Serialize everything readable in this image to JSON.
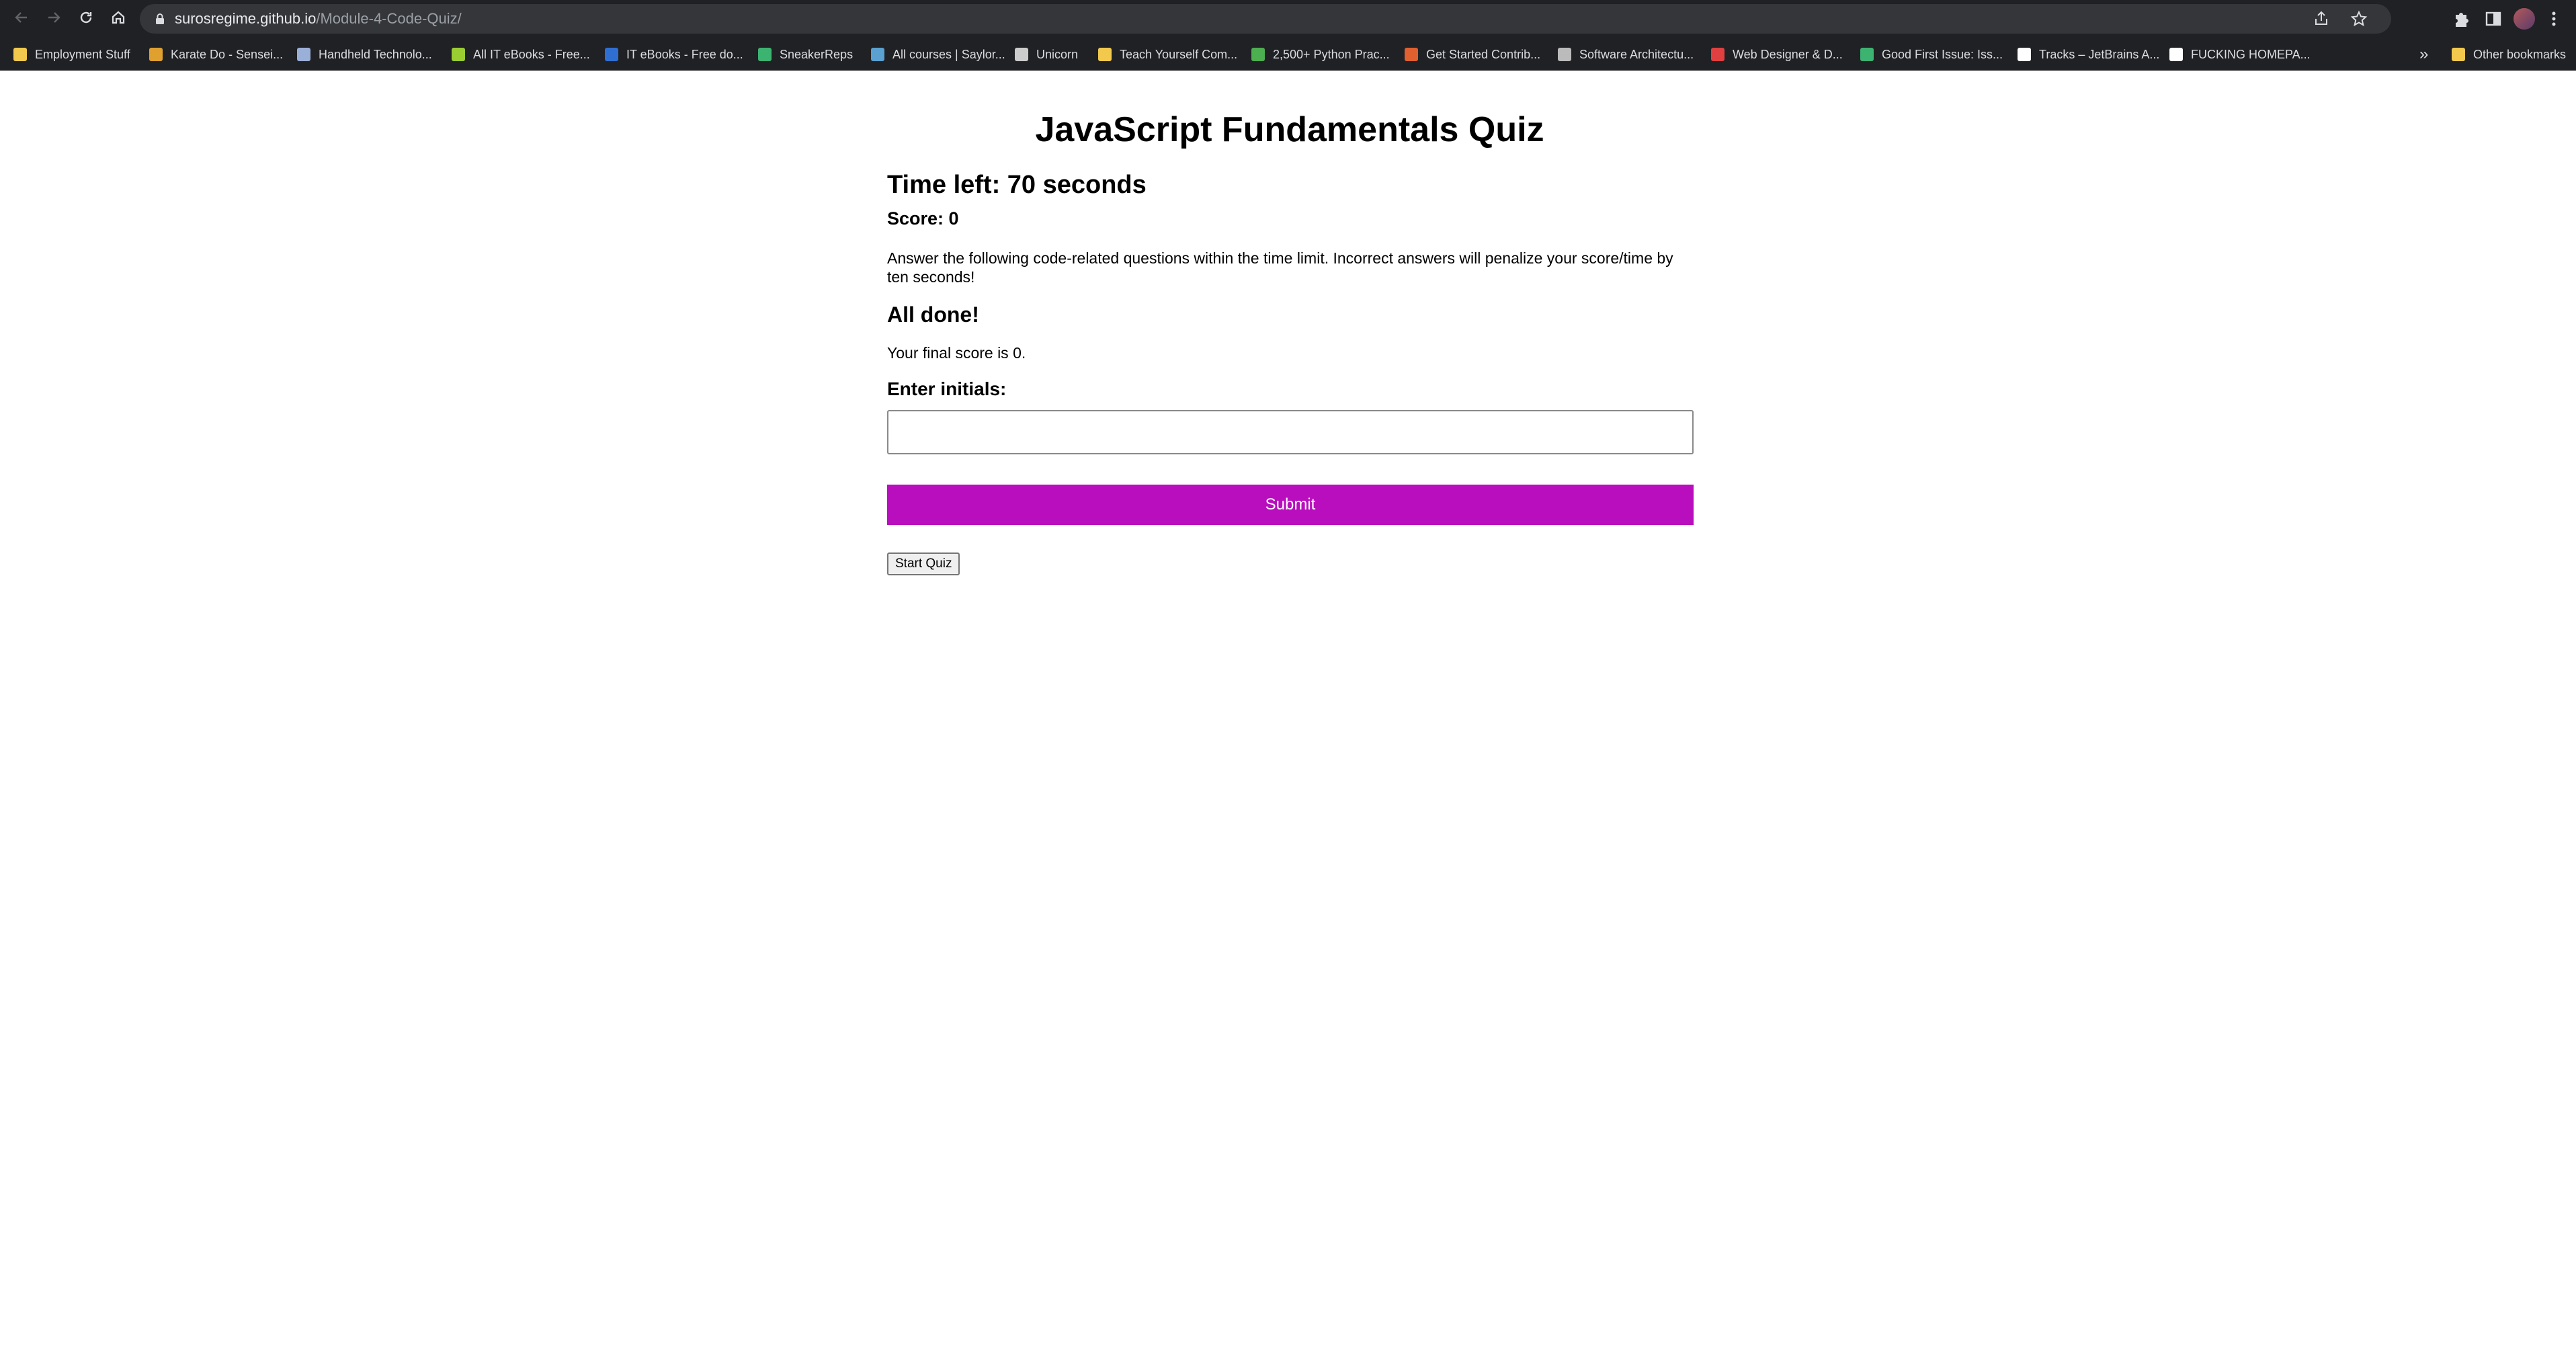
{
  "browser": {
    "url_host": "surosregime.github.io",
    "url_path": "/Module-4-Code-Quiz/",
    "bookmarks": [
      {
        "label": "Employment Stuff",
        "icon": "folder-icon",
        "color": "#f2c94c"
      },
      {
        "label": "Karate Do - Sensei...",
        "icon": "karate-icon",
        "color": "#e0a030"
      },
      {
        "label": "Handheld Technolo...",
        "icon": "glasses-icon",
        "color": "#9bb0d8"
      },
      {
        "label": "All IT eBooks - Free...",
        "icon": "leaf-icon",
        "color": "#9acd32"
      },
      {
        "label": "IT eBooks - Free do...",
        "icon": "book-icon",
        "color": "#2f6fd1"
      },
      {
        "label": "SneakerReps",
        "icon": "flag-icon",
        "color": "#3cb371"
      },
      {
        "label": "All courses | Saylor...",
        "icon": "saylor-icon",
        "color": "#5aa0d0"
      },
      {
        "label": "Unicorn",
        "icon": "unicorn-icon",
        "color": "#cccccc"
      },
      {
        "label": "Teach Yourself Com...",
        "icon": "key-icon",
        "color": "#f2c94c"
      },
      {
        "label": "2,500+ Python Prac...",
        "icon": "python-icon",
        "color": "#4caf50"
      },
      {
        "label": "Get Started Contrib...",
        "icon": "github-icon",
        "color": "#e06030"
      },
      {
        "label": "Software Architectu...",
        "icon": "globe-icon",
        "color": "#bbbbbb"
      },
      {
        "label": "Web Designer & D...",
        "icon": "envelope-icon",
        "color": "#e04040"
      },
      {
        "label": "Good First Issue: Iss...",
        "icon": "gfi-icon",
        "color": "#3cb371"
      },
      {
        "label": "Tracks – JetBrains A...",
        "icon": "jetbrains-icon",
        "color": "#ffffff"
      },
      {
        "label": "FUCKING HOMEPA...",
        "icon": "fh-icon",
        "color": "#ffffff"
      }
    ],
    "bookmarks_more": "»",
    "other_bookmarks": "Other bookmarks"
  },
  "quiz": {
    "title": "JavaScript Fundamentals Quiz",
    "timer": "Time left: 70 seconds",
    "score": "Score: 0",
    "instructions": "Answer the following code-related questions within the time limit. Incorrect answers will penalize your score/time by ten seconds!",
    "done_heading": "All done!",
    "final_score": "Your final score is 0.",
    "initials_label": "Enter initials:",
    "initials_value": "",
    "submit_label": "Submit",
    "start_label": "Start Quiz",
    "accent_color": "#b90ebe"
  }
}
